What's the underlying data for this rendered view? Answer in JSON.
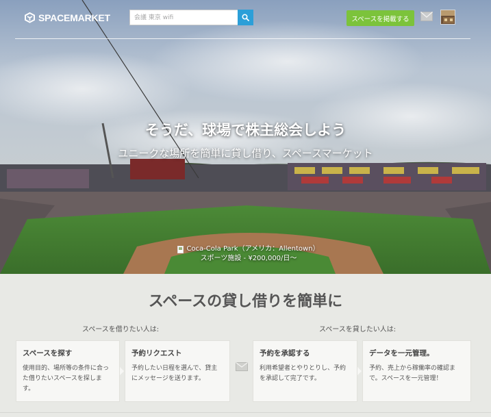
{
  "header": {
    "logo_text": "SPACEMARKET",
    "search_placeholder": "会議 東京 wifi",
    "post_button": "スペースを掲載する",
    "icons": {
      "logo": "spacemarket-logo-icon",
      "search": "search-icon",
      "mail": "mail-icon",
      "avatar": "user-avatar"
    }
  },
  "hero": {
    "title": "そうだ、球場で株主総会しよう",
    "subtitle": "ユニークな場所を簡単に貸し借り、スペースマーケット",
    "caption_line1": "Coca-Cola Park（アメリカ：Allentown）",
    "caption_line2": "スポーツ施設 - ¥200,000/日～"
  },
  "how": {
    "title": "スペースの貸し借りを簡単に",
    "renter_label": "スペースを借りたい人は:",
    "host_label": "スペースを貸したい人は:",
    "cards": [
      {
        "title": "スペースを探す",
        "desc": "使用目的、場所等の条件に合った借りたいスペースを探します。"
      },
      {
        "title": "予約リクエスト",
        "desc": "予約したい日程を選んで、貸主にメッセージを送ります。"
      },
      {
        "title": "予約を承認する",
        "desc": "利用希望者とやりとりし、予約を承認して完了です。"
      },
      {
        "title": "データを一元管理。",
        "desc": "予約、売上から稼働率の確認まで。スペースを一元管理！"
      }
    ]
  },
  "colors": {
    "accent_blue": "#2c9fd8",
    "accent_green": "#7cc33b",
    "section_bg": "#e8e9e5"
  }
}
